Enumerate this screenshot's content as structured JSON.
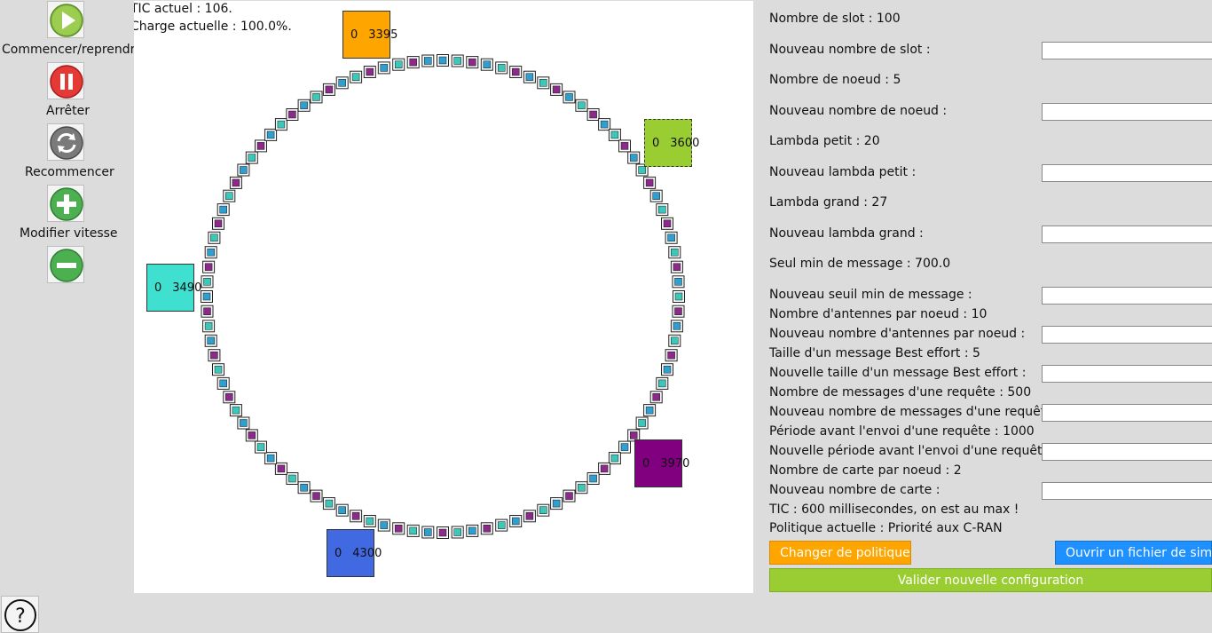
{
  "controls": {
    "start_label": "Commencer/reprendre",
    "stop_label": "Arrêter",
    "restart_label": "Recommencer",
    "speed_label": "Modifier vitesse"
  },
  "status": {
    "tic_line": "TIC actuel : 106.",
    "load_line": "Charge actuelle : 100.0%."
  },
  "ring": {
    "slot_count": 100,
    "slot_colors": [
      "#2f9fd0",
      "#3c8f3c",
      "#8b2a8b",
      "#e09b20",
      "#2a3fb0",
      "#3cc8b8",
      "#6a1070",
      "#7aaa30"
    ]
  },
  "nodes": [
    {
      "id": "node-top",
      "value_a": "0",
      "value_b": "3395",
      "color": "#ffa500",
      "style": "solid"
    },
    {
      "id": "node-right-top",
      "value_a": "0",
      "value_b": "3600",
      "color": "#9acd32",
      "style": "dashed"
    },
    {
      "id": "node-left",
      "value_a": "0",
      "value_b": "3490",
      "color": "#40e0d0",
      "style": "solid"
    },
    {
      "id": "node-right-bottom",
      "value_a": "0",
      "value_b": "3970",
      "color": "#800080",
      "style": "solid"
    },
    {
      "id": "node-bottom",
      "value_a": "0",
      "value_b": "4300",
      "color": "#4169e1",
      "style": "solid"
    }
  ],
  "config": {
    "slot": "Nombre de slot : 100",
    "new_slot": "Nouveau nombre de slot :",
    "nodes": "Nombre de noeud : 5",
    "new_nodes": "Nouveau nombre de noeud :",
    "lambda_small": "Lambda petit : 20",
    "new_lambda_small": "Nouveau lambda petit :",
    "lambda_big": "Lambda grand : 27",
    "new_lambda_big": "Nouveau lambda grand :",
    "min_msg": "Seul min de message : 700.0",
    "new_min_msg": "Nouveau seuil min de message :",
    "antennas": "Nombre d'antennes par noeud : 10",
    "new_antennas": "Nouveau nombre d'antennes par noeud :",
    "be_size": "Taille d'un message Best effort : 5",
    "new_be_size": "Nouvelle taille d'un message Best effort :",
    "req_msgs": "Nombre de messages d'une requête : 500",
    "new_req_msgs": "Nouveau nombre de messages d'une requête :",
    "period": "Période avant l'envoi d'une requête : 1000",
    "new_period": "Nouvelle période avant l'envoi d'une requête :",
    "cards": "Nombre de carte par noeud : 2",
    "new_cards": "Nouveau nombre de carte :",
    "tic_info": "TIC : 600 millisecondes, on est au max !",
    "policy": "Politique actuelle : Priorité aux C-RAN",
    "change_policy_btn": "Changer de politique",
    "open_file_btn": "Ouvrir un fichier de simulation",
    "validate_btn": "Valider nouvelle configuration"
  },
  "colors": {
    "orange_button": "#ffa500",
    "blue_button": "#1e90ff",
    "green_button": "#9acd32"
  }
}
